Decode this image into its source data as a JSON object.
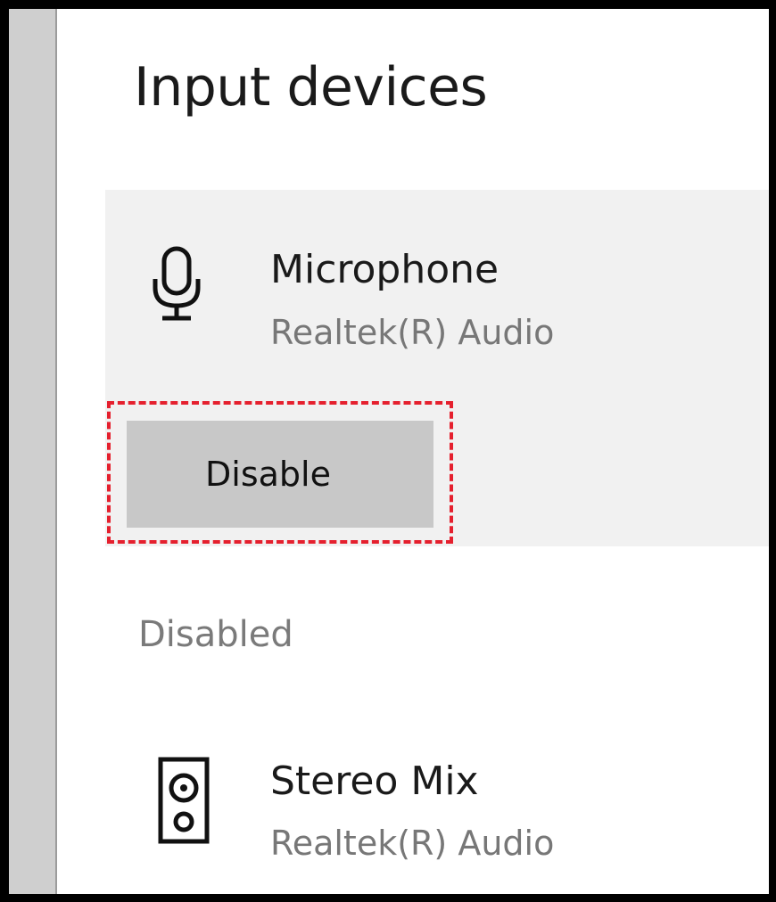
{
  "page": {
    "title": "Input devices"
  },
  "devices": [
    {
      "name": "Microphone",
      "subtitle": "Realtek(R) Audio",
      "icon": "microphone-icon",
      "action_label": "Disable"
    },
    {
      "name": "Stereo Mix",
      "subtitle": "Realtek(R) Audio",
      "icon": "speaker-icon"
    }
  ],
  "sections": {
    "disabled_label": "Disabled"
  },
  "colors": {
    "highlight": "#e5202e",
    "card_background": "#f1f1f1",
    "button_background": "#c8c8c8"
  }
}
